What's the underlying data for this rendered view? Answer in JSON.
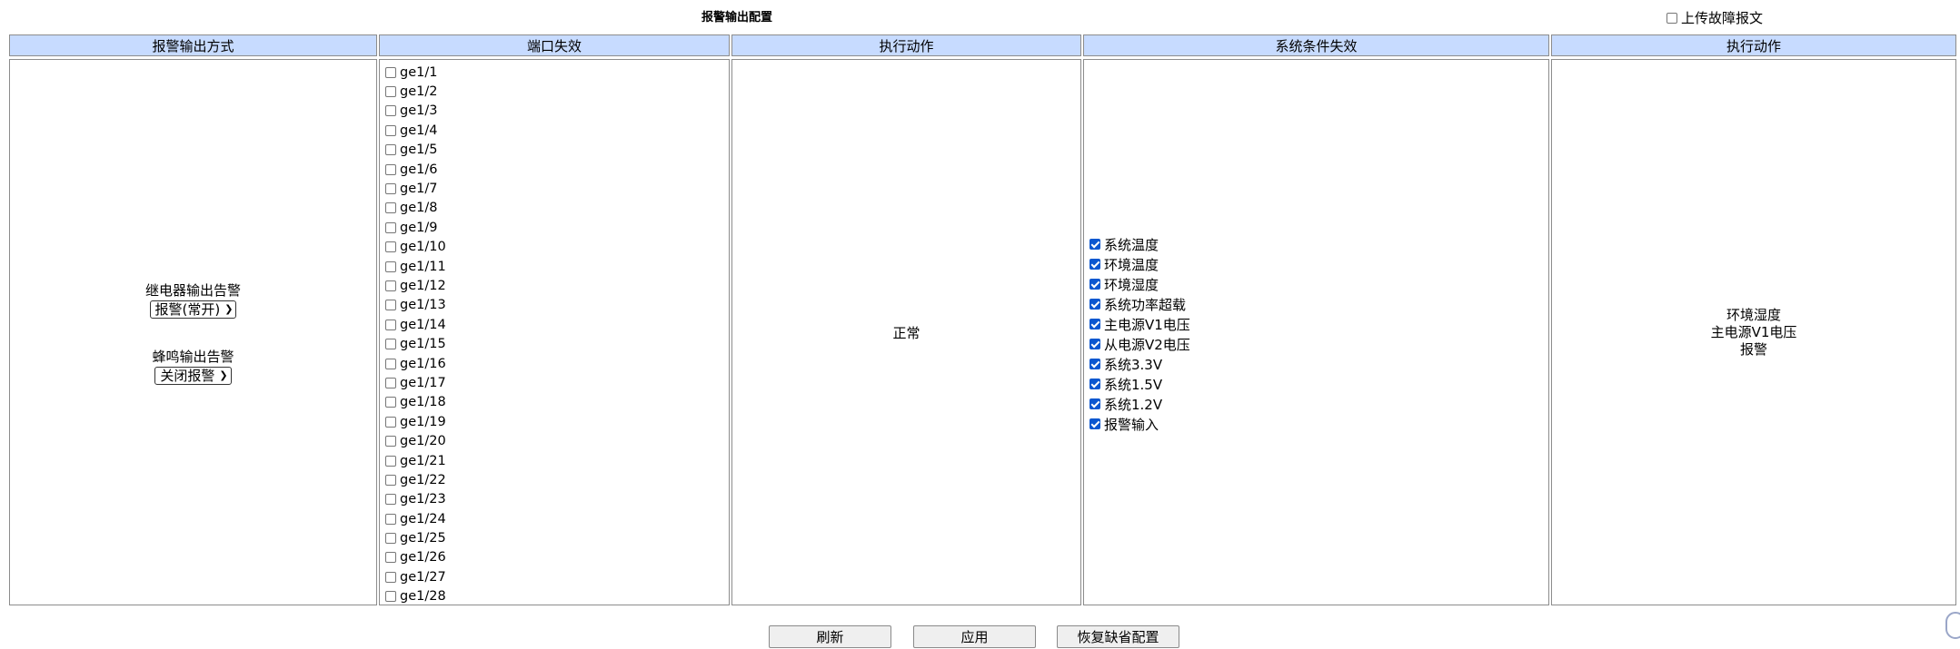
{
  "page": {
    "title": "报警输出配置",
    "upload_label": "上传故障报文",
    "upload_checked": false
  },
  "headers": [
    "报警输出方式",
    "端口失效",
    "执行动作",
    "系统条件失效",
    "执行动作"
  ],
  "alarm_output": {
    "relay_label": "继电器输出告警",
    "relay_value": "报警(常开)",
    "buzzer_label": "蜂鸣输出告警",
    "buzzer_value": "关闭报警"
  },
  "ports": [
    "ge1/1",
    "ge1/2",
    "ge1/3",
    "ge1/4",
    "ge1/5",
    "ge1/6",
    "ge1/7",
    "ge1/8",
    "ge1/9",
    "ge1/10",
    "ge1/11",
    "ge1/12",
    "ge1/13",
    "ge1/14",
    "ge1/15",
    "ge1/16",
    "ge1/17",
    "ge1/18",
    "ge1/19",
    "ge1/20",
    "ge1/21",
    "ge1/22",
    "ge1/23",
    "ge1/24",
    "ge1/25",
    "ge1/26",
    "ge1/27",
    "ge1/28"
  ],
  "port_action": "正常",
  "conditions": [
    {
      "label": "系统温度",
      "checked": true
    },
    {
      "label": "环境温度",
      "checked": true
    },
    {
      "label": "环境湿度",
      "checked": true
    },
    {
      "label": "系统功率超载",
      "checked": true
    },
    {
      "label": "主电源V1电压",
      "checked": true
    },
    {
      "label": "从电源V2电压",
      "checked": true
    },
    {
      "label": "系统3.3V",
      "checked": true
    },
    {
      "label": "系统1.5V",
      "checked": true
    },
    {
      "label": "系统1.2V",
      "checked": true
    },
    {
      "label": "报警输入",
      "checked": true
    }
  ],
  "condition_action": [
    "环境湿度",
    "主电源V1电压",
    "报警"
  ],
  "buttons": {
    "refresh": "刷新",
    "apply": "应用",
    "restore": "恢复缺省配置"
  },
  "icons": {
    "checkbox": "checkbox-icon",
    "dropdown": "chevron-down-icon"
  },
  "colors": {
    "header_bg": "#c7dbff",
    "checkbox_checked": "#0b57d0"
  }
}
